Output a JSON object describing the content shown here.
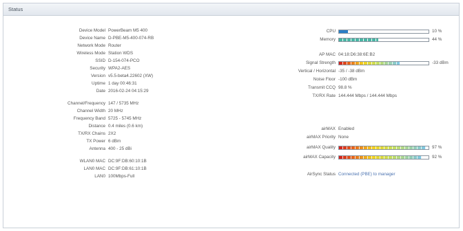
{
  "panel": {
    "title": "Status"
  },
  "left": [
    {
      "label": "Device Model",
      "value": "PowerBeam M5 400"
    },
    {
      "label": "Device Name",
      "value": "D-PBE-M5-400-074-RB"
    },
    {
      "label": "Network Mode",
      "value": "Router"
    },
    {
      "label": "Wireless Mode",
      "value": "Station WDS"
    },
    {
      "label": "SSID",
      "value": "D-154-074-PCO"
    },
    {
      "label": "Security",
      "value": "WPA2-AES"
    },
    {
      "label": "Version",
      "value": "v5.5-beta4.22602 (XW)"
    },
    {
      "label": "Uptime",
      "value": "1 day 00:46:31"
    },
    {
      "label": "Date",
      "value": "2016-02-24 04:15:29"
    },
    {
      "label": "Channel/Frequency",
      "value": "147 / 5735 MHz"
    },
    {
      "label": "Channel Width",
      "value": "20 MHz"
    },
    {
      "label": "Frequency Band",
      "value": "5725 - 5745 MHz"
    },
    {
      "label": "Distance",
      "value": "0.4 miles (0.6 km)"
    },
    {
      "label": "TX/RX Chains",
      "value": "2X2"
    },
    {
      "label": "TX Power",
      "value": "6 dBm"
    },
    {
      "label": "Antenna",
      "value": "400 - 25 dBi"
    },
    {
      "label": "WLAN0 MAC",
      "value": "DC:9F:DB:60:10:1B"
    },
    {
      "label": "LAN0 MAC",
      "value": "DC:9F:DB:61:10:1B"
    },
    {
      "label": "LAN0",
      "value": "100Mbps-Full"
    }
  ],
  "cpu": {
    "label": "CPU",
    "percent": 10,
    "pct_text": "10 %"
  },
  "memory": {
    "label": "Memory",
    "percent": 44,
    "pct_text": "44 %"
  },
  "right_info": [
    {
      "label": "AP MAC",
      "value": "04:18:D6:38:6E:B2"
    }
  ],
  "signal": {
    "label": "Signal Strength",
    "percent": 68,
    "value": "-33 dBm"
  },
  "right_more": [
    {
      "label": "Vertical / Horizontal",
      "value": "-35 / -38 dBm"
    },
    {
      "label": "Noise Floor",
      "value": "-100 dBm"
    },
    {
      "label": "Transmit CCQ",
      "value": "98.8 %"
    },
    {
      "label": "TX/RX Rate",
      "value": "144.444 Mbps / 144.444 Mbps"
    }
  ],
  "airmax": {
    "label": "airMAX",
    "value": "Enabled"
  },
  "airmax_priority": {
    "label": "airMAX Priority",
    "value": "None"
  },
  "airmax_quality": {
    "label": "airMAX Quality",
    "percent": 97,
    "value": "97 %"
  },
  "airmax_capacity": {
    "label": "airMAX Capacity",
    "percent": 92,
    "value": "92 %"
  },
  "airsync": {
    "label": "AirSync Status",
    "link": "Connected (PBE) to manager"
  },
  "colors": {
    "cpu_fill": "#2b7fc6",
    "memory_fill": "#49b5a4",
    "link": "#4a72b0"
  }
}
